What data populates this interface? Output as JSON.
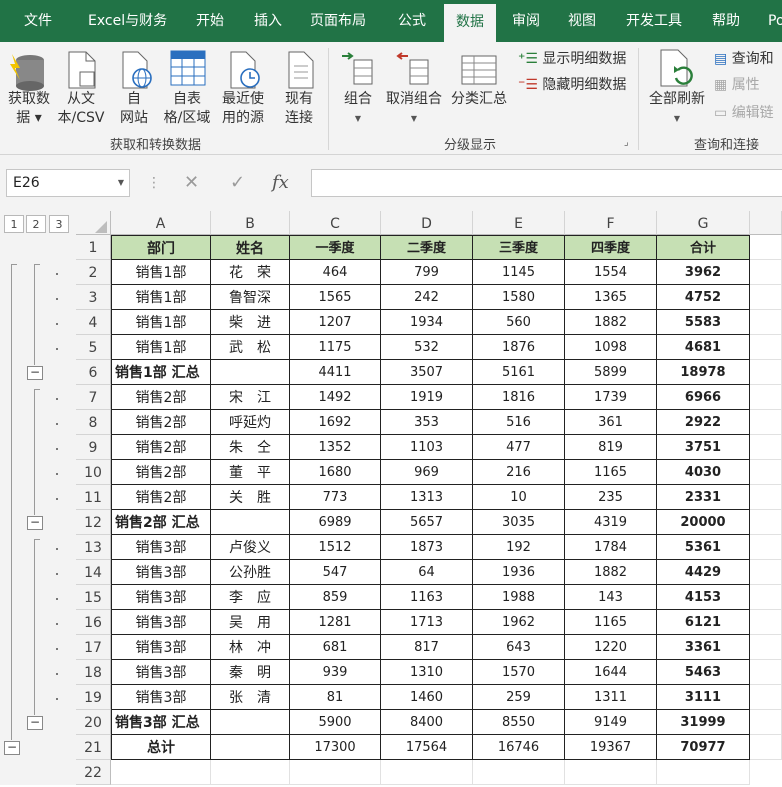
{
  "ribbon_tabs": [
    "文件",
    "Excel与财务",
    "开始",
    "插入",
    "页面布局",
    "公式",
    "数据",
    "审阅",
    "视图",
    "开发工具",
    "帮助",
    "Po"
  ],
  "active_tab": "数据",
  "ribbon": {
    "get_data": [
      "获取数",
      "据 ▾"
    ],
    "from_csv": [
      "从文",
      "本/CSV"
    ],
    "from_web": [
      "自",
      "网站"
    ],
    "from_table": [
      "自表",
      "格/区域"
    ],
    "recent_sources": [
      "最近使",
      "用的源"
    ],
    "existing_conn": [
      "现有",
      "连接"
    ],
    "group_label_get": "获取和转换数据",
    "group": "组合",
    "ungroup": "取消组合",
    "subtotal": "分类汇总",
    "show_detail": "显示明细数据",
    "hide_detail": "隐藏明细数据",
    "group_label_outline": "分级显示",
    "refresh_all": "全部刷新",
    "queries_conn": "查询和",
    "properties": "属性",
    "edit_links": "编辑链",
    "group_label_queries": "查询和连接"
  },
  "formula_bar": {
    "name_box": "E26",
    "cancel": "✕",
    "enter": "✓",
    "fx": "fx",
    "formula": ""
  },
  "outline_levels": [
    "1",
    "2",
    "3"
  ],
  "columns": [
    "A",
    "B",
    "C",
    "D",
    "E",
    "F",
    "G"
  ],
  "rows": [
    {
      "r": "1",
      "cells": [
        "部门",
        "姓名",
        "一季度",
        "二季度",
        "三季度",
        "四季度",
        "合计"
      ],
      "type": "header"
    },
    {
      "r": "2",
      "cells": [
        "销售1部",
        "花　荣",
        "464",
        "799",
        "1145",
        "1554",
        "3962"
      ],
      "type": "data"
    },
    {
      "r": "3",
      "cells": [
        "销售1部",
        "鲁智深",
        "1565",
        "242",
        "1580",
        "1365",
        "4752"
      ],
      "type": "data"
    },
    {
      "r": "4",
      "cells": [
        "销售1部",
        "柴　进",
        "1207",
        "1934",
        "560",
        "1882",
        "5583"
      ],
      "type": "data"
    },
    {
      "r": "5",
      "cells": [
        "销售1部",
        "武　松",
        "1175",
        "532",
        "1876",
        "1098",
        "4681"
      ],
      "type": "data"
    },
    {
      "r": "6",
      "cells": [
        "销售1部 汇总",
        "",
        "4411",
        "3507",
        "5161",
        "5899",
        "18978"
      ],
      "type": "subtotal"
    },
    {
      "r": "7",
      "cells": [
        "销售2部",
        "宋　江",
        "1492",
        "1919",
        "1816",
        "1739",
        "6966"
      ],
      "type": "data"
    },
    {
      "r": "8",
      "cells": [
        "销售2部",
        "呼延灼",
        "1692",
        "353",
        "516",
        "361",
        "2922"
      ],
      "type": "data"
    },
    {
      "r": "9",
      "cells": [
        "销售2部",
        "朱　仝",
        "1352",
        "1103",
        "477",
        "819",
        "3751"
      ],
      "type": "data"
    },
    {
      "r": "10",
      "cells": [
        "销售2部",
        "董　平",
        "1680",
        "969",
        "216",
        "1165",
        "4030"
      ],
      "type": "data"
    },
    {
      "r": "11",
      "cells": [
        "销售2部",
        "关　胜",
        "773",
        "1313",
        "10",
        "235",
        "2331"
      ],
      "type": "data"
    },
    {
      "r": "12",
      "cells": [
        "销售2部 汇总",
        "",
        "6989",
        "5657",
        "3035",
        "4319",
        "20000"
      ],
      "type": "subtotal"
    },
    {
      "r": "13",
      "cells": [
        "销售3部",
        "卢俊义",
        "1512",
        "1873",
        "192",
        "1784",
        "5361"
      ],
      "type": "data"
    },
    {
      "r": "14",
      "cells": [
        "销售3部",
        "公孙胜",
        "547",
        "64",
        "1936",
        "1882",
        "4429"
      ],
      "type": "data"
    },
    {
      "r": "15",
      "cells": [
        "销售3部",
        "李　应",
        "859",
        "1163",
        "1988",
        "143",
        "4153"
      ],
      "type": "data"
    },
    {
      "r": "16",
      "cells": [
        "销售3部",
        "吴　用",
        "1281",
        "1713",
        "1962",
        "1165",
        "6121"
      ],
      "type": "data"
    },
    {
      "r": "17",
      "cells": [
        "销售3部",
        "林　冲",
        "681",
        "817",
        "643",
        "1220",
        "3361"
      ],
      "type": "data"
    },
    {
      "r": "18",
      "cells": [
        "销售3部",
        "秦　明",
        "939",
        "1310",
        "1570",
        "1644",
        "5463"
      ],
      "type": "data"
    },
    {
      "r": "19",
      "cells": [
        "销售3部",
        "张　清",
        "81",
        "1460",
        "259",
        "1311",
        "3111"
      ],
      "type": "data"
    },
    {
      "r": "20",
      "cells": [
        "销售3部 汇总",
        "",
        "5900",
        "8400",
        "8550",
        "9149",
        "31999"
      ],
      "type": "subtotal"
    },
    {
      "r": "21",
      "cells": [
        "总计",
        "",
        "17300",
        "17564",
        "16746",
        "19367",
        "70977"
      ],
      "type": "total"
    },
    {
      "r": "22",
      "cells": [
        "",
        "",
        "",
        "",
        "",
        "",
        ""
      ],
      "type": "empty"
    }
  ],
  "colors": {
    "ribbon_green": "#217346",
    "header_fill": "#c6e0b4"
  }
}
